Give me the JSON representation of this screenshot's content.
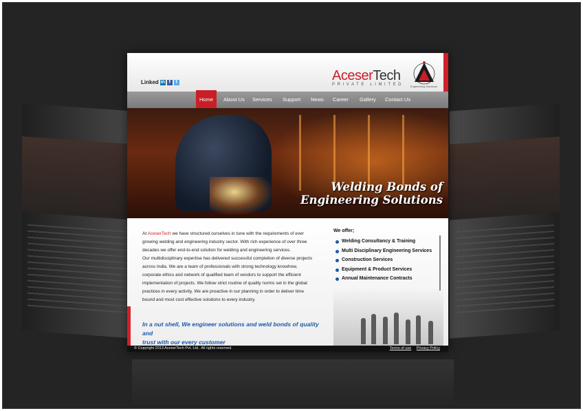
{
  "social": {
    "linkedin_label": "Linked",
    "linkedin_icon": "in",
    "facebook_icon": "f",
    "twitter_icon": "t"
  },
  "logo": {
    "name_part1": "Aceser",
    "name_part2": "Tech",
    "subtitle": "PRIVATE LIMITED",
    "emblem_caption": "Engineering Solutions"
  },
  "nav": {
    "items": [
      "Home",
      "About Us",
      "Services",
      "Support",
      "News",
      "Career",
      "Gallery",
      "Contact Us"
    ],
    "active": "Home"
  },
  "banner": {
    "tagline_line1": "Welding Bonds of",
    "tagline_line2": "Engineering Solutions"
  },
  "content": {
    "intro_prefix": "At",
    "company": "AceserTech",
    "lines": [
      " we have structured ourselves in tune with the requirements of ever",
      "growing welding and engineering industry sector. With rich experience of over three",
      "decades we offer end-to-end solution for welding and engineering services.",
      "Our  multidisciplinary expertise has delivered successful completion of diverse projects",
      "across India. We are a team of professionals with strong technology knowhow,",
      "corporate ethics and network of qualified team of vendors to support the efficient",
      " implementation of projects. We follow strict routine of quality norms set in the global",
      "practices in every activity. We are proactive in our planning in order to deliver time",
      "bound and most cost effective solutions to every industry."
    ],
    "nutshell_line1": "In a nut shell, We engineer solutions and weld bonds of quality and",
    "nutshell_line2": "trust with our every customer"
  },
  "offer": {
    "title": "We offer;",
    "items": [
      "Welding Consultancy & Training",
      "Multi Disciplinary Engineering Services",
      "Construction Services",
      "Equipment & Product Services",
      "Annual Maintenance Contracts"
    ]
  },
  "footer": {
    "copyright": "© Copyright 2013 AceserTech Pvt. Ltd.. All rights reserved.",
    "terms": "Terms of use",
    "privacy": "Privacy Policy"
  },
  "colors": {
    "accent_red": "#c81f26",
    "link_blue": "#1a5aa8",
    "nav_gray": "#8a8a8a"
  }
}
